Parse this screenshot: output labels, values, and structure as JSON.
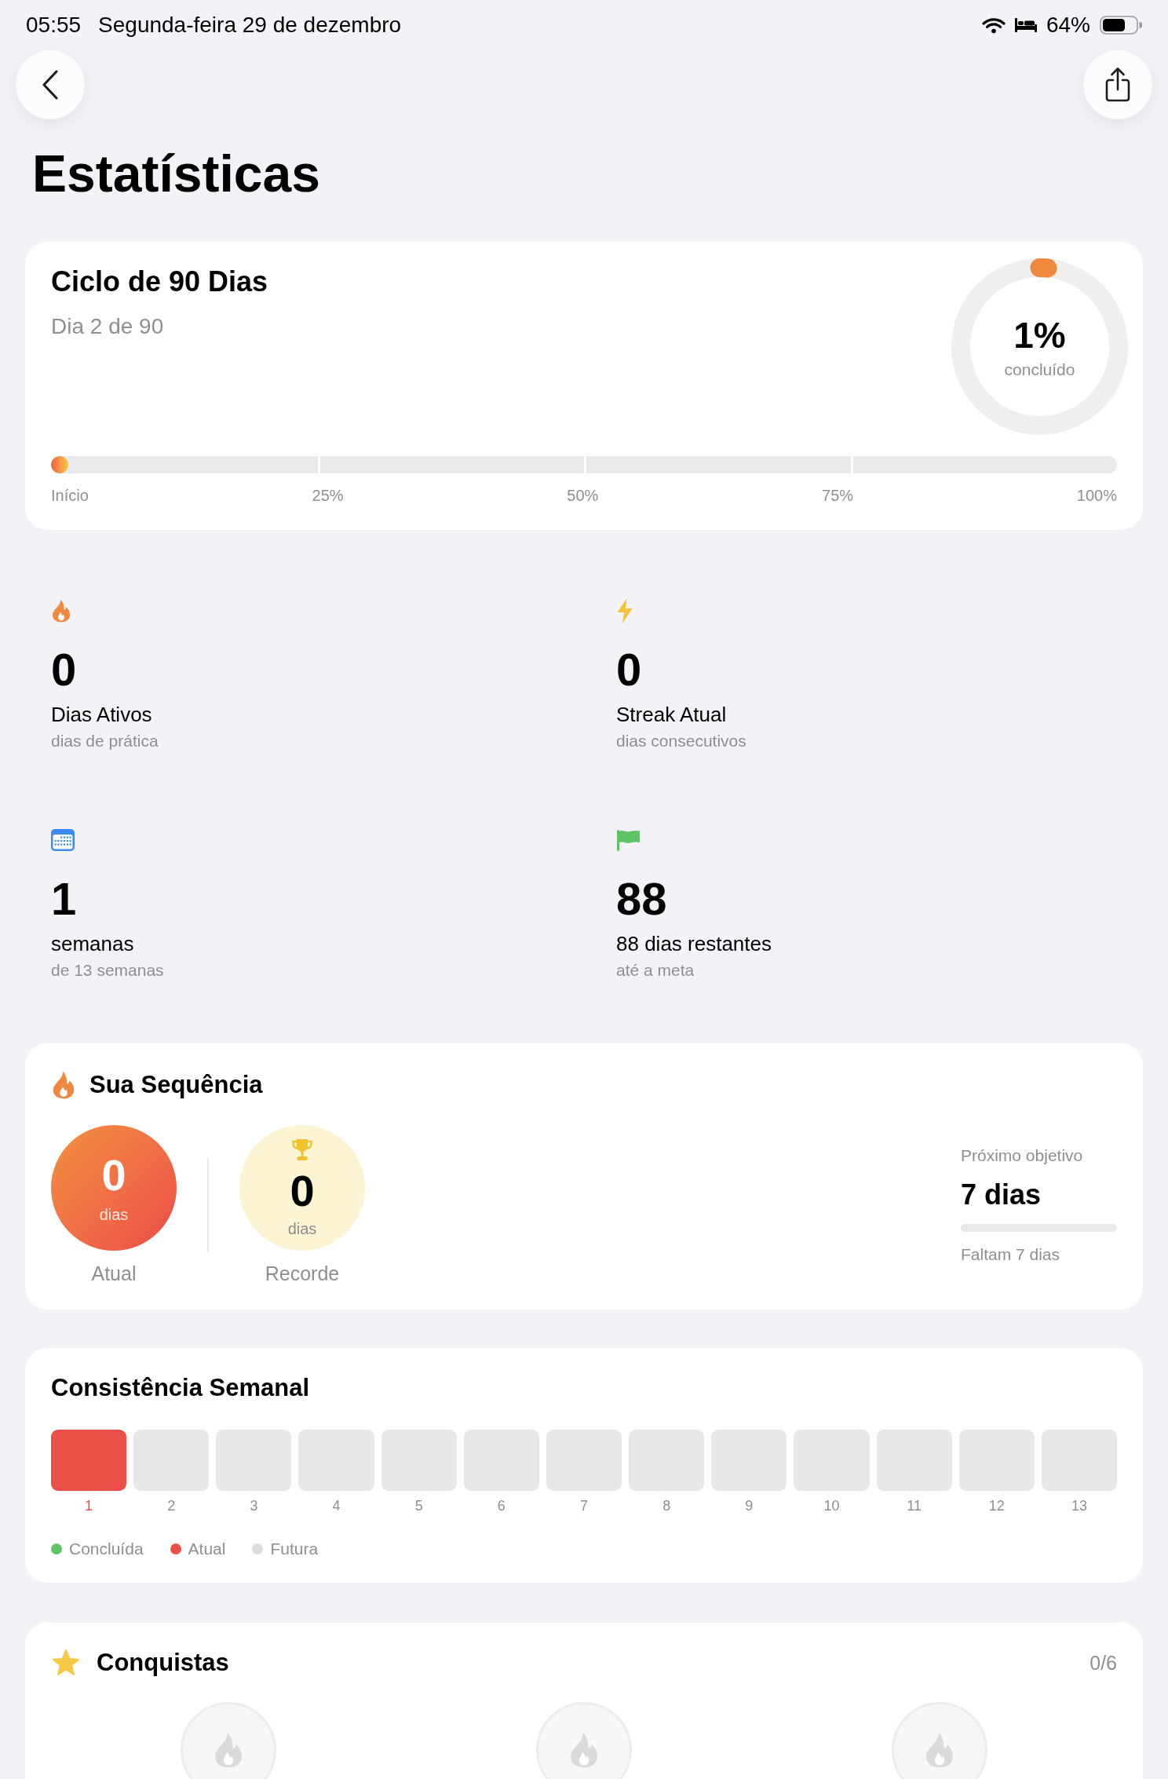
{
  "status_bar": {
    "time": "05:55",
    "date": "Segunda-feira 29 de dezembro",
    "battery": "64%"
  },
  "header": {
    "title": "Estatísticas"
  },
  "cycle_card": {
    "title": "Ciclo de 90 Dias",
    "subtitle": "Dia 2 de 90",
    "level": 0.016,
    "ring": {
      "value": "1%",
      "caption": "concluído"
    },
    "progress": {
      "labels": [
        "Início",
        "25%",
        "50%",
        "75%",
        "100%"
      ]
    }
  },
  "stats": [
    {
      "value": "0",
      "label": "Dias Ativos",
      "caption": "dias de prática"
    },
    {
      "value": "0",
      "label": "Streak Atual",
      "caption": "dias consecutivos"
    },
    {
      "value": "1",
      "label": "semanas",
      "caption": "de 13 semanas"
    },
    {
      "value": "88",
      "label": "88 dias restantes",
      "caption": "até a meta"
    }
  ],
  "streak_card": {
    "title": "Sua Sequência",
    "current": {
      "value": "0",
      "unit": "dias",
      "label": "Atual"
    },
    "record": {
      "value": "0",
      "unit": "dias",
      "label": "Recorde"
    },
    "next_goal": {
      "label": "Próximo objetivo",
      "value": "7 dias",
      "caption": "Faltam 7 dias"
    }
  },
  "weekly_card": {
    "title": "Consistência Semanal",
    "weeks": [
      {
        "label": "1",
        "current": true
      },
      {
        "label": "2",
        "current": false
      },
      {
        "label": "3",
        "current": false
      },
      {
        "label": "4",
        "current": false
      },
      {
        "label": "5",
        "current": false
      },
      {
        "label": "6",
        "current": false
      },
      {
        "label": "7",
        "current": false
      },
      {
        "label": "8",
        "current": false
      },
      {
        "label": "9",
        "current": false
      },
      {
        "label": "10",
        "current": false
      },
      {
        "label": "11",
        "current": false
      },
      {
        "label": "12",
        "current": false
      },
      {
        "label": "13",
        "current": false
      }
    ],
    "legend": [
      {
        "label": "Concluída",
        "color": "#62c466"
      },
      {
        "label": "Atual",
        "color": "#ea4f48"
      },
      {
        "label": "Futura",
        "color": "#dddddd"
      }
    ]
  },
  "achievements": {
    "title": "Conquistas",
    "count": "0/6",
    "items": [
      {
        "unlocked": false
      },
      {
        "unlocked": false
      },
      {
        "unlocked": false
      }
    ]
  }
}
